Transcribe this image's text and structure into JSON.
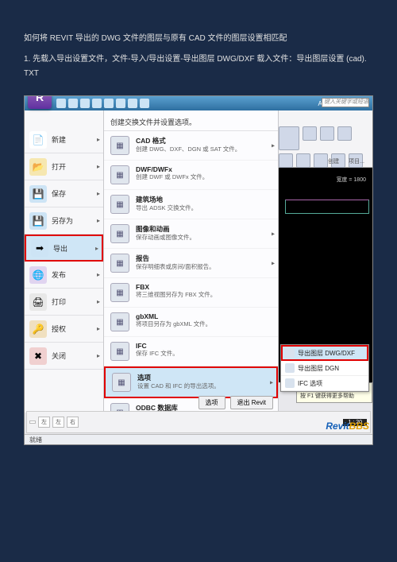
{
  "doc": {
    "title": "如何将 REVIT 导出的 DWG 文件的图层与原有 CAD 文件的图层设置相匹配",
    "step1": "1. 先载入导出设置文件，文件-导入/导出设置-导出图层 DWG/DXF 载入文件：导出图层设置 (cad). TXT"
  },
  "titlebar": {
    "app": "Autodesk Revit...",
    "search": "键入关键字或短语"
  },
  "ribbon": {
    "labels": [
      "创建",
      "项目..."
    ]
  },
  "bigR": "R",
  "leftmenu": [
    {
      "label": "新建",
      "ico": "📄"
    },
    {
      "label": "打开",
      "ico": "📂"
    },
    {
      "label": "保存",
      "ico": "💾"
    },
    {
      "label": "另存为",
      "ico": "💾"
    },
    {
      "label": "导出",
      "ico": "➡",
      "hl": true
    },
    {
      "label": "发布",
      "ico": "🌐"
    },
    {
      "label": "打印",
      "ico": "🖨"
    },
    {
      "label": "授权",
      "ico": "🔑"
    },
    {
      "label": "关闭",
      "ico": "✖"
    }
  ],
  "subpanel": {
    "header": "创建交换文件并设置选项。",
    "items": [
      {
        "title": "CAD 格式",
        "desc": "创建 DWG、DXF、DGN 或 SAT 文件。",
        "arrow": true
      },
      {
        "title": "DWF/DWFx",
        "desc": "创建 DWF 或 DWFx 文件。"
      },
      {
        "title": "建筑场地",
        "desc": "导出 ADSK 交换文件。"
      },
      {
        "title": "图像和动画",
        "desc": "保存动画或图像文件。",
        "arrow": true
      },
      {
        "title": "报告",
        "desc": "保存明细表或房间/面积报告。",
        "arrow": true
      },
      {
        "title": "FBX",
        "desc": "将三维视图另存为 FBX 文件。"
      },
      {
        "title": "gbXML",
        "desc": "将项目另存为 gbXML 文件。"
      },
      {
        "title": "IFC",
        "desc": "保存 IFC 文件。"
      },
      {
        "title": "选项",
        "desc": "设置 CAD 和 IFC 的导出选项。",
        "arrow": true,
        "hl": true
      },
      {
        "title": "ODBC 数据库",
        "desc": ""
      }
    ],
    "buttons": {
      "options": "选项",
      "exit": "退出 Revit"
    }
  },
  "flyout": [
    {
      "label": "导出图层 DWG/DXF",
      "hl": true
    },
    {
      "label": "导出图层 DGN"
    },
    {
      "label": "IFC 选项"
    }
  ],
  "tooltip": {
    "t": "导出图层 DWG/DXF",
    "h": "按 F1 键获得更多帮助"
  },
  "canvas": {
    "dim": "宽度 = 1800"
  },
  "bottombar": {
    "ruler": "1 : 20",
    "boxes": [
      "",
      "左",
      "左",
      "右"
    ]
  },
  "status": "就绪",
  "watermark": {
    "a": "Revit",
    "b": "BBS"
  }
}
